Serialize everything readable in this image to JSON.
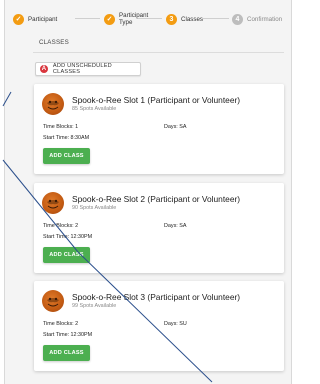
{
  "stepper": {
    "steps": [
      {
        "label": "Participant",
        "state": "done",
        "symbol": "✓"
      },
      {
        "label": "Participant Type",
        "state": "done",
        "symbol": "✓"
      },
      {
        "label": "Classes",
        "state": "active",
        "symbol": "3"
      },
      {
        "label": "Confirmation",
        "state": "pending",
        "symbol": "4"
      }
    ]
  },
  "tab": {
    "label": "CLASSES"
  },
  "unscheduled_button": {
    "label": "ADD UNSCHEDULED CLASSES",
    "icon_symbol": "A"
  },
  "classes": [
    {
      "title": "Spook-o-Ree Slot 1 (Participant or Volunteer)",
      "spots": "85 Spots Available",
      "time_blocks": "Time Blocks: 1",
      "days": "Days: SA",
      "start_time": "Start Time: 8:30AM",
      "button": "ADD CLASS"
    },
    {
      "title": "Spook-o-Ree Slot 2 (Participant or Volunteer)",
      "spots": "90 Spots Available",
      "time_blocks": "Time Blocks: 2",
      "days": "Days: SA",
      "start_time": "Start Time: 12:30PM",
      "button": "ADD CLASS"
    },
    {
      "title": "Spook-o-Ree Slot 3 (Participant or Volunteer)",
      "spots": "99 Spots Available",
      "time_blocks": "Time Blocks: 2",
      "days": "Days: SU",
      "start_time": "Start Time: 12:30PM",
      "button": "ADD CLASS"
    }
  ],
  "colors": {
    "accent": "#f39c12",
    "add_button": "#4caf50",
    "danger": "#d9363e",
    "annotation_line": "#2b4f8c"
  }
}
